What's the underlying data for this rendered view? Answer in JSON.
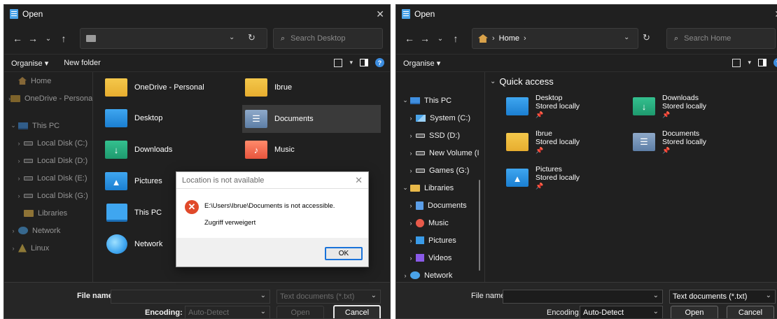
{
  "left": {
    "title": "Open",
    "address_text": "",
    "search_placeholder": "Search Desktop",
    "cmd": {
      "organise": "Organise ▾",
      "new_folder": "New folder"
    },
    "nav_items": [
      {
        "label": "Home",
        "icon": "home-icon"
      },
      {
        "label": "OneDrive - Persona",
        "icon": "onedrive-folder-icon"
      },
      {
        "label": "This PC",
        "icon": "pc-icon"
      },
      {
        "label": "Local Disk (C:)",
        "icon": "drive-icon"
      },
      {
        "label": "Local Disk (D:)",
        "icon": "drive-icon"
      },
      {
        "label": "Local Disk (E:)",
        "icon": "drive-icon"
      },
      {
        "label": "Local Disk (G:)",
        "icon": "drive-icon"
      },
      {
        "label": "Libraries",
        "icon": "libraries-folder-icon"
      },
      {
        "label": "Network",
        "icon": "network-icon"
      },
      {
        "label": "Linux",
        "icon": "linux-icon"
      }
    ],
    "tiles": [
      {
        "label": "OneDrive - Personal",
        "icon": "folder-icon"
      },
      {
        "label": "Ibrue",
        "icon": "folder-icon"
      },
      {
        "label": "Desktop",
        "icon": "desktop-folder-icon"
      },
      {
        "label": "Documents",
        "icon": "documents-folder-icon"
      },
      {
        "label": "Downloads",
        "icon": "downloads-folder-icon"
      },
      {
        "label": "Music",
        "icon": "music-folder-icon"
      },
      {
        "label": "Pictures",
        "icon": "pictures-folder-icon"
      },
      {
        "label": "This PC",
        "icon": "pc-icon"
      },
      {
        "label": "Network",
        "icon": "network-icon"
      }
    ],
    "bottom": {
      "file_name_label": "File name:",
      "file_name_value": "",
      "filter": "Text documents (*.txt)",
      "encoding_label": "Encoding:",
      "encoding_value": "Auto-Detect",
      "open": "Open",
      "cancel": "Cancel"
    },
    "dialog": {
      "title": "Location is not available",
      "message": "E:\\Users\\Ibrue\\Documents is not accessible.",
      "detail": "Zugriff verweigert",
      "ok": "OK"
    }
  },
  "right": {
    "title": "Open",
    "breadcrumb": [
      "Home",
      "›"
    ],
    "search_placeholder": "Search Home",
    "cmd": {
      "organise": "Organise ▾"
    },
    "nav_items": [
      {
        "label": "This PC",
        "icon": "pc-icon"
      },
      {
        "label": "System (C:)",
        "icon": "system-drive-icon"
      },
      {
        "label": "SSD (D:)",
        "icon": "drive-icon"
      },
      {
        "label": "New Volume (I",
        "icon": "drive-icon"
      },
      {
        "label": "Games (G:)",
        "icon": "drive-icon"
      },
      {
        "label": "Libraries",
        "icon": "libraries-folder-icon"
      },
      {
        "label": "Documents",
        "icon": "documents-icon"
      },
      {
        "label": "Music",
        "icon": "music-icon"
      },
      {
        "label": "Pictures",
        "icon": "pictures-icon"
      },
      {
        "label": "Videos",
        "icon": "videos-icon"
      },
      {
        "label": "Network",
        "icon": "network-icon"
      }
    ],
    "section": "Quick access",
    "quick_access": [
      {
        "name": "Desktop",
        "status": "Stored locally",
        "icon": "desktop-folder-icon"
      },
      {
        "name": "Downloads",
        "status": "Stored locally",
        "icon": "downloads-folder-icon"
      },
      {
        "name": "Ibrue",
        "status": "Stored locally",
        "icon": "folder-icon"
      },
      {
        "name": "Documents",
        "status": "Stored locally",
        "icon": "documents-folder-icon"
      },
      {
        "name": "Pictures",
        "status": "Stored locally",
        "icon": "pictures-folder-icon"
      }
    ],
    "bottom": {
      "file_name_label": "File name:",
      "file_name_value": "",
      "filter": "Text documents (*.txt)",
      "encoding_label": "Encoding:",
      "encoding_value": "Auto-Detect",
      "open": "Open",
      "cancel": "Cancel"
    }
  }
}
